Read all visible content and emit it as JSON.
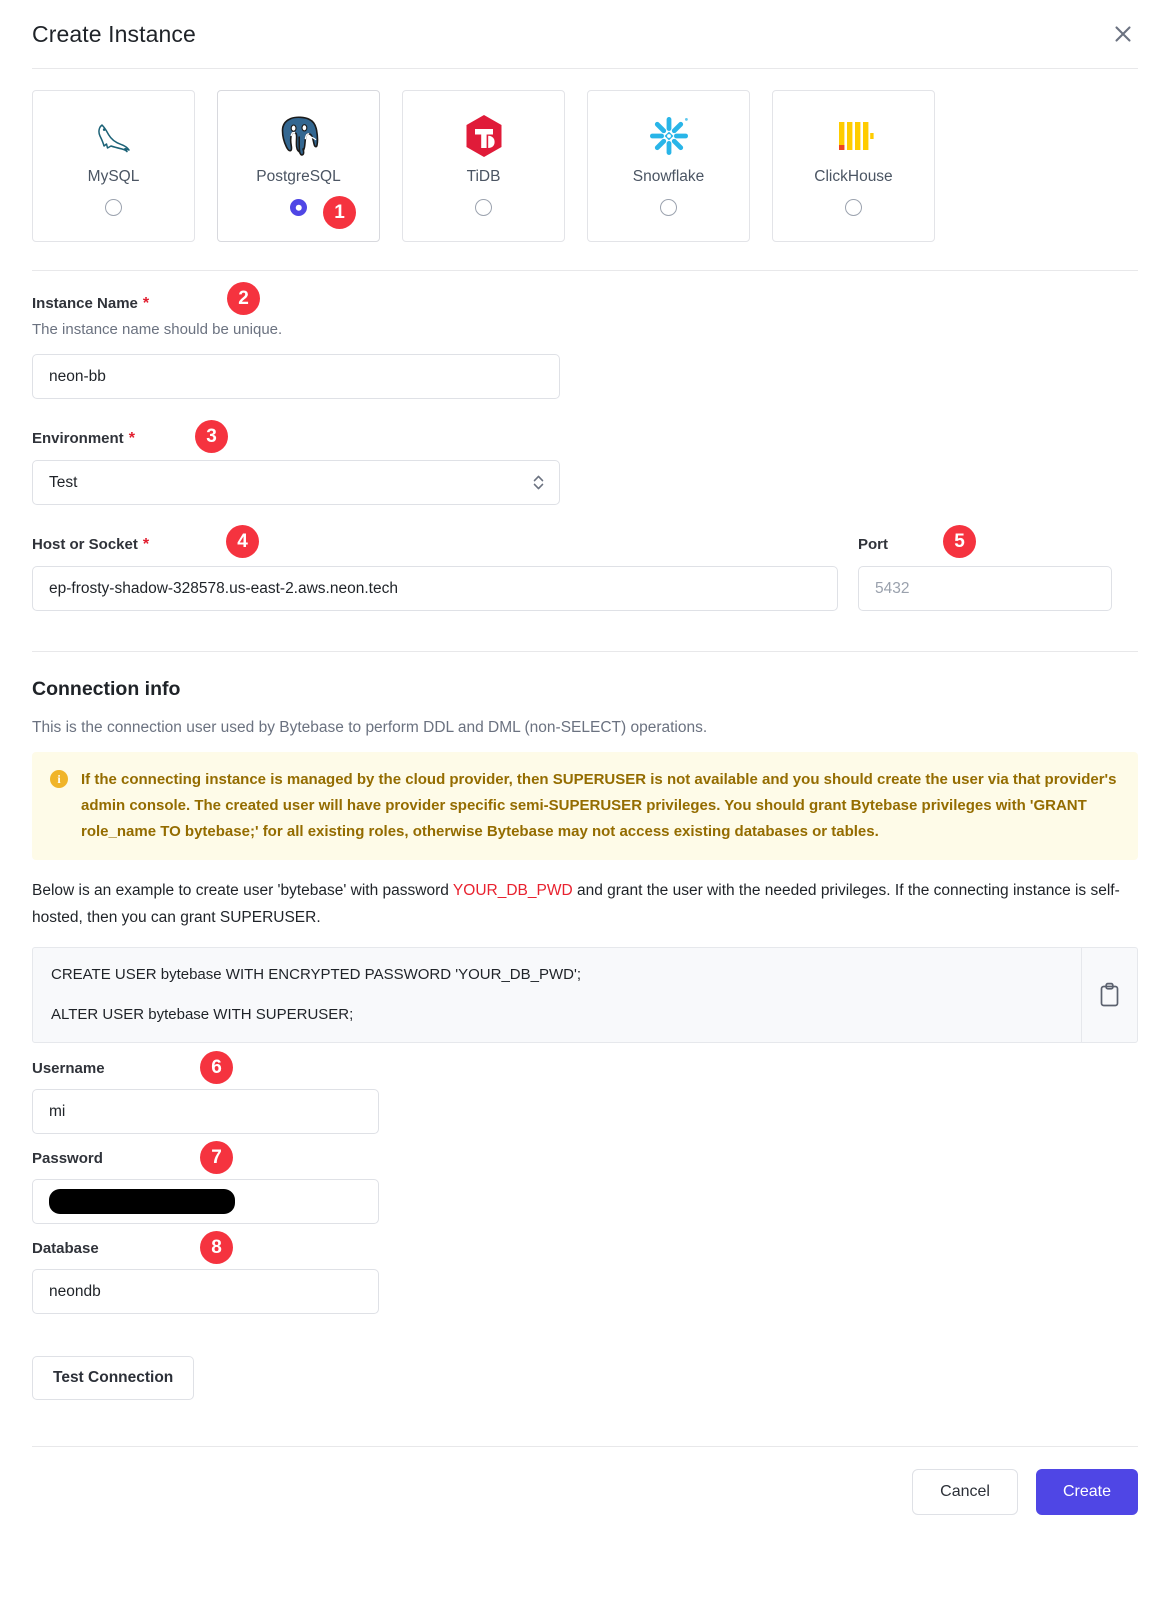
{
  "dialog": {
    "title": "Create Instance",
    "close_icon": "close-icon"
  },
  "engines": [
    {
      "label": "MySQL",
      "icon": "mysql-logo-icon",
      "selected": false
    },
    {
      "label": "PostgreSQL",
      "icon": "postgresql-logo-icon",
      "selected": true
    },
    {
      "label": "TiDB",
      "icon": "tidb-logo-icon",
      "selected": false
    },
    {
      "label": "Snowflake",
      "icon": "snowflake-logo-icon",
      "selected": false
    },
    {
      "label": "ClickHouse",
      "icon": "clickhouse-logo-icon",
      "selected": false
    }
  ],
  "markers": [
    "1",
    "2",
    "3",
    "4",
    "5",
    "6",
    "7",
    "8"
  ],
  "form": {
    "instance_name": {
      "label": "Instance Name",
      "required_mark": "*",
      "hint": "The instance name should be unique.",
      "value": "neon-bb"
    },
    "environment": {
      "label": "Environment",
      "required_mark": "*",
      "value": "Test",
      "options": [
        "Test"
      ]
    },
    "host": {
      "label": "Host or Socket",
      "required_mark": "*",
      "value": "ep-frosty-shadow-328578.us-east-2.aws.neon.tech"
    },
    "port": {
      "label": "Port",
      "placeholder": "5432",
      "value": ""
    }
  },
  "connection": {
    "title": "Connection info",
    "subtitle": "This is the connection user used by Bytebase to perform DDL and DML (non-SELECT) operations.",
    "alert": {
      "icon": "info-icon",
      "text": "If the connecting instance is managed by the cloud provider, then SUPERUSER is not available and you should create the user via that provider's admin console. The created user will have provider specific semi-SUPERUSER privileges. You should grant Bytebase privileges with 'GRANT role_name TO bytebase;' for all existing roles, otherwise Bytebase may not access existing databases or tables."
    },
    "example_text_before": "Below is an example to create user 'bytebase' with password ",
    "example_highlight": "YOUR_DB_PWD",
    "example_text_after": " and grant the user with the needed privileges. If the connecting instance is self-hosted, then you can grant SUPERUSER.",
    "code": {
      "line1": "CREATE USER bytebase WITH ENCRYPTED PASSWORD 'YOUR_DB_PWD';",
      "line2": "ALTER USER bytebase WITH SUPERUSER;",
      "copy_icon": "clipboard-copy-icon"
    },
    "username": {
      "label": "Username",
      "value": "mi"
    },
    "password": {
      "label": "Password",
      "value": "",
      "redacted": true
    },
    "database": {
      "label": "Database",
      "value": "neondb"
    },
    "test_connection_label": "Test Connection"
  },
  "footer": {
    "cancel_label": "Cancel",
    "create_label": "Create"
  },
  "colors": {
    "primary": "#4f46e5",
    "marker": "#f5333f",
    "required": "#e11d2e",
    "alert_bg": "#fefbe8",
    "alert_text": "#946c00",
    "highlight": "#e8222f"
  }
}
